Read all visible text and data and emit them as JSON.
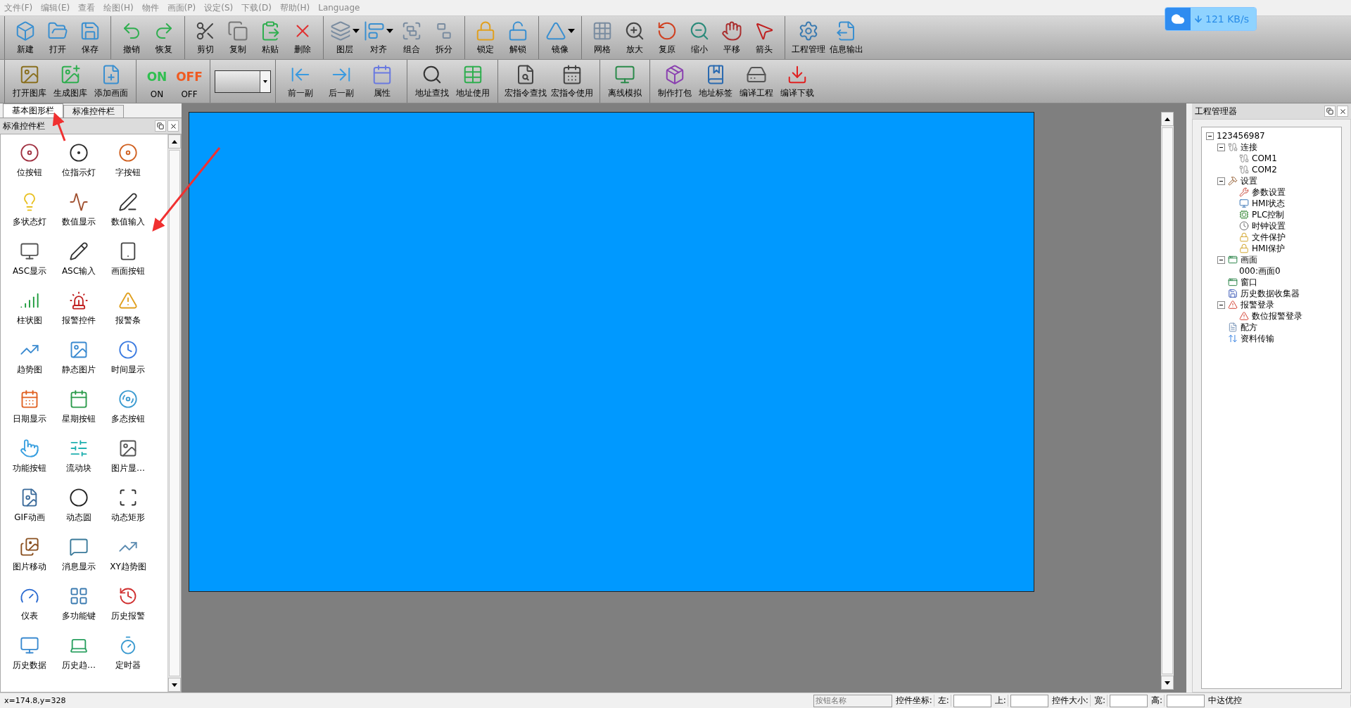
{
  "menu_bar": [
    {
      "label": "文件(F)"
    },
    {
      "label": "编辑(E)"
    },
    {
      "label": "查看"
    },
    {
      "label": "绘图(H)"
    },
    {
      "label": "物件"
    },
    {
      "label": "画面(P)"
    },
    {
      "label": "设定(S)"
    },
    {
      "label": "下载(D)"
    },
    {
      "label": "帮助(H)"
    },
    {
      "label": "Language"
    }
  ],
  "main_toolbar": [
    [
      {
        "label": "新建",
        "menu": false
      },
      {
        "label": "打开",
        "menu": false
      },
      {
        "label": "保存",
        "menu": false
      }
    ],
    [
      {
        "label": "撤销",
        "menu": false
      },
      {
        "label": "恢复",
        "menu": false
      }
    ],
    [
      {
        "label": "剪切",
        "menu": false
      },
      {
        "label": "复制",
        "menu": false
      },
      {
        "label": "粘贴",
        "menu": false
      },
      {
        "label": "删除",
        "menu": false
      }
    ],
    [
      {
        "label": "图层",
        "menu": true
      },
      {
        "label": "对齐",
        "menu": true
      },
      {
        "label": "组合",
        "menu": false
      },
      {
        "label": "拆分",
        "menu": false
      }
    ],
    [
      {
        "label": "锁定",
        "menu": false
      },
      {
        "label": "解锁",
        "menu": false
      }
    ],
    [
      {
        "label": "镜像",
        "menu": true
      }
    ],
    [
      {
        "label": "网格",
        "menu": false
      },
      {
        "label": "放大",
        "menu": false
      },
      {
        "label": "复原",
        "menu": false
      },
      {
        "label": "缩小",
        "menu": false
      },
      {
        "label": "平移",
        "menu": false
      },
      {
        "label": "箭头",
        "menu": false
      }
    ],
    [
      {
        "label": "工程管理",
        "menu": false
      },
      {
        "label": "信息输出",
        "menu": false
      }
    ]
  ],
  "second_toolbar": [
    [
      {
        "kind": "button",
        "label": "打开图库"
      },
      {
        "kind": "button",
        "label": "生成图库"
      },
      {
        "kind": "button",
        "label": "添加画面"
      }
    ],
    [
      {
        "kind": "switch",
        "label": "ON",
        "icon_text": "ON"
      },
      {
        "kind": "switch",
        "label": "OFF",
        "icon_text": "OFF"
      }
    ],
    [
      {
        "kind": "combo"
      }
    ],
    [
      {
        "kind": "button",
        "label": "前一副"
      },
      {
        "kind": "button",
        "label": "后一副"
      },
      {
        "kind": "button",
        "label": "属性"
      }
    ],
    [
      {
        "kind": "button",
        "label": "地址查找"
      },
      {
        "kind": "button",
        "label": "地址使用"
      }
    ],
    [
      {
        "kind": "button",
        "label": "宏指令查找"
      },
      {
        "kind": "button",
        "label": "宏指令使用"
      }
    ],
    [
      {
        "kind": "button",
        "label": "离线模拟"
      }
    ],
    [
      {
        "kind": "button",
        "label": "制作打包"
      },
      {
        "kind": "button",
        "label": "地址标签"
      },
      {
        "kind": "button",
        "label": "编译工程"
      },
      {
        "kind": "button",
        "label": "编译下载"
      }
    ]
  ],
  "speed_widget": {
    "reading": "121 KB/s"
  },
  "left_panel": {
    "tabs": [
      {
        "label": "基本图形栏",
        "selected": true
      },
      {
        "label": "标准控件栏",
        "selected": false
      }
    ],
    "title": "标准控件栏",
    "items": [
      {
        "label": "位按钮"
      },
      {
        "label": "位指示灯"
      },
      {
        "label": "字按钮"
      },
      {
        "label": "多状态灯"
      },
      {
        "label": "数值显示"
      },
      {
        "label": "数值输入"
      },
      {
        "label": "ASC显示"
      },
      {
        "label": "ASC输入"
      },
      {
        "label": "画面按钮"
      },
      {
        "label": "柱状图"
      },
      {
        "label": "报警控件"
      },
      {
        "label": "报警条"
      },
      {
        "label": "趋势图"
      },
      {
        "label": "静态图片"
      },
      {
        "label": "时间显示"
      },
      {
        "label": "日期显示"
      },
      {
        "label": "星期按钮"
      },
      {
        "label": "多态按钮"
      },
      {
        "label": "功能按钮"
      },
      {
        "label": "流动块"
      },
      {
        "label": "图片显…"
      },
      {
        "label": "GIF动画"
      },
      {
        "label": "动态圆"
      },
      {
        "label": "动态矩形"
      },
      {
        "label": "图片移动"
      },
      {
        "label": "消息显示"
      },
      {
        "label": "XY趋势图"
      },
      {
        "label": "仪表"
      },
      {
        "label": "多功能键"
      },
      {
        "label": "历史报警"
      },
      {
        "label": "历史数据"
      },
      {
        "label": "历史趋…"
      },
      {
        "label": "定时器"
      }
    ]
  },
  "right_panel": {
    "title": "工程管理器",
    "tree": [
      {
        "label": "123456987",
        "expanded": true,
        "children": [
          {
            "label": "连接",
            "expanded": true,
            "children": [
              {
                "label": "COM1"
              },
              {
                "label": "COM2"
              }
            ]
          },
          {
            "label": "设置",
            "expanded": true,
            "children": [
              {
                "label": "参数设置"
              },
              {
                "label": "HMI状态"
              },
              {
                "label": "PLC控制"
              },
              {
                "label": "时钟设置"
              },
              {
                "label": "文件保护"
              },
              {
                "label": "HMI保护"
              }
            ]
          },
          {
            "label": "画面",
            "expanded": true,
            "children": [
              {
                "label": "000:画面0"
              }
            ]
          },
          {
            "label": "窗口"
          },
          {
            "label": "历史数据收集器"
          },
          {
            "label": "报警登录",
            "expanded": true,
            "children": [
              {
                "label": "数位报警登录"
              }
            ]
          },
          {
            "label": "配方"
          },
          {
            "label": "资料传输"
          }
        ]
      }
    ]
  },
  "status_bar": {
    "cursor": "x=174.8,y=328",
    "name_placeholder": "按钮名称",
    "position_label": "控件坐标:",
    "left_label": "左:",
    "top_label": "上:",
    "size_label": "控件大小:",
    "width_label": "宽:",
    "height_label": "高:",
    "brand": "中达优控"
  }
}
